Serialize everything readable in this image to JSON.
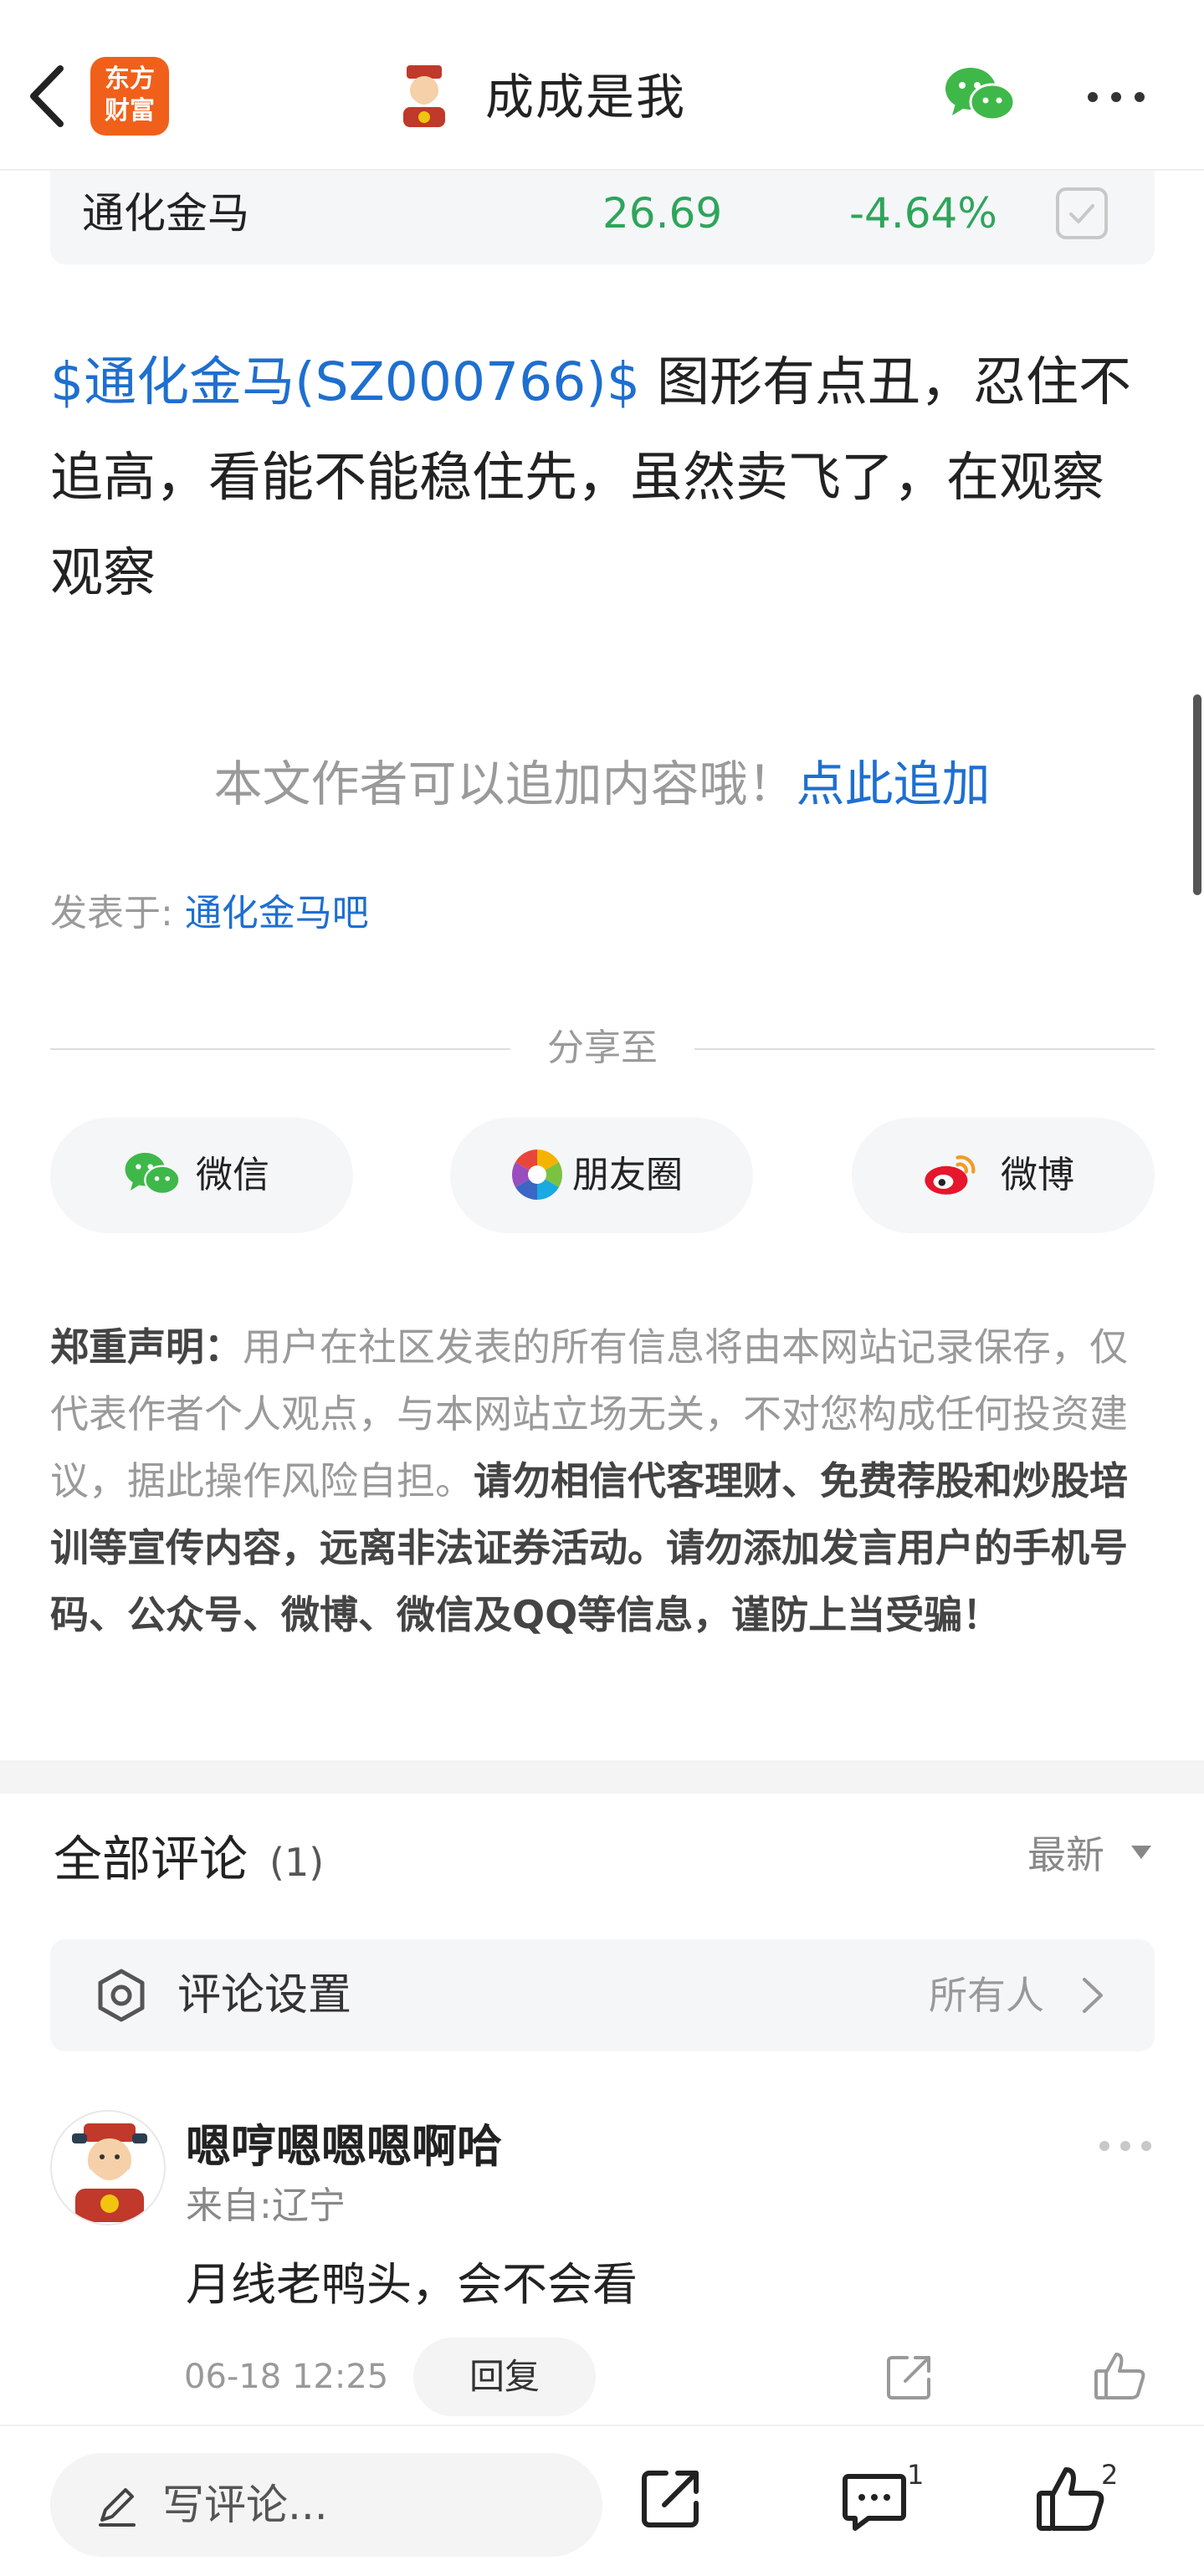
{
  "header": {
    "logo_line1": "东方",
    "logo_line2": "财富",
    "author_name": "成成是我"
  },
  "stock_card": {
    "name": "通化金马",
    "price": "26.69",
    "change": "-4.64%"
  },
  "post": {
    "stock_tag": "$通化金马(SZ000766)$",
    "body": " 图形有点丑，忍住不追高，看能不能稳住先，虽然卖飞了，在观察观察"
  },
  "append": {
    "text": "本文作者可以追加内容哦！",
    "link": "点此追加"
  },
  "posted_in": {
    "label": "发表于: ",
    "bar": "通化金马吧"
  },
  "share": {
    "title": "分享至",
    "buttons": [
      {
        "label": "微信",
        "icon": "wechat-icon"
      },
      {
        "label": "朋友圈",
        "icon": "moments-icon"
      },
      {
        "label": "微博",
        "icon": "weibo-icon"
      }
    ]
  },
  "disclaimer": {
    "title": "郑重声明：",
    "text": "用户在社区发表的所有信息将由本网站记录保存，仅代表作者个人观点，与本网站立场无关，不对您构成任何投资建议，据此操作风险自担。",
    "warning": "请勿相信代客理财、免费荐股和炒股培训等宣传内容，远离非法证券活动。请勿添加发言用户的手机号码、公众号、微博、微信及QQ等信息，谨防上当受骗！"
  },
  "comments": {
    "title": "全部评论",
    "count": "(1)",
    "sort": "最新",
    "settings_label": "评论设置",
    "settings_value": "所有人",
    "items": [
      {
        "user": "嗯哼嗯嗯嗯啊哈",
        "location": "来自:辽宁",
        "text": "月线老鸭头，会不会看",
        "time": "06-18 12:25",
        "reply_label": "回复"
      }
    ]
  },
  "bottom_bar": {
    "write_placeholder": "写评论...",
    "comment_count": "1",
    "like_count": "2"
  },
  "colors": {
    "accent_blue": "#1e6fd0",
    "stock_green": "#2ea55b",
    "logo_orange": "#f0601a",
    "wechat_green": "#3fb84a",
    "weibo_red": "#e6162d"
  }
}
